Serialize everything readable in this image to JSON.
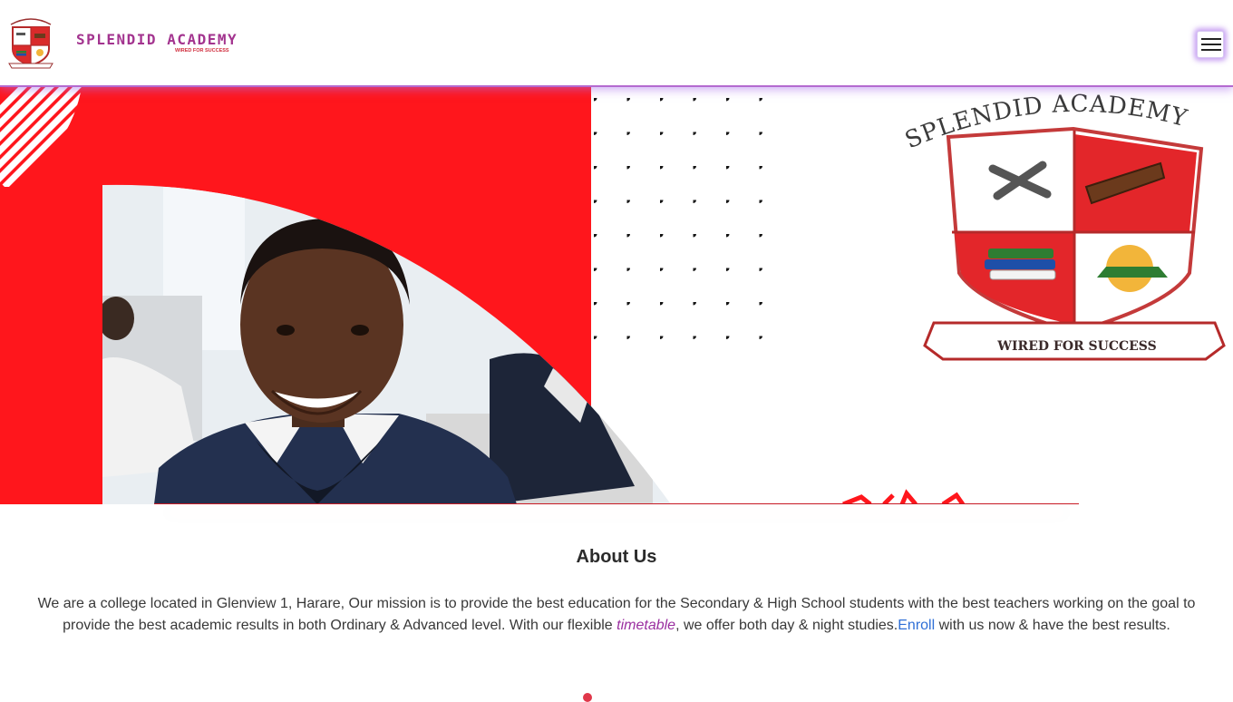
{
  "navbar": {
    "brand_name": "SPLENDID ACADEMY",
    "brand_tagline": "WIRED FOR SUCCESS",
    "menu_icon": "hamburger-menu-icon"
  },
  "hero": {
    "crest_arc_text": "SPLENDID ACADEMY",
    "crest_banner_text": "WIRED FOR SUCCESS"
  },
  "about": {
    "title": "About Us",
    "text_1": "We are a college located in Glenview 1, Harare, Our mission is to provide the best education for the Secondary & High School students with the best teachers working on the goal to provide the best academic results in both Ordinary & Advanced level. With our flexible ",
    "timetable_link": "timetable",
    "text_2": ", we offer both day & night studies.",
    "enroll_link": "Enroll",
    "text_3": " with us now & have the best results."
  },
  "colors": {
    "accent_purple": "#a3348f",
    "brand_red": "#ff1a1f",
    "link_blue": "#2f6fd6"
  }
}
